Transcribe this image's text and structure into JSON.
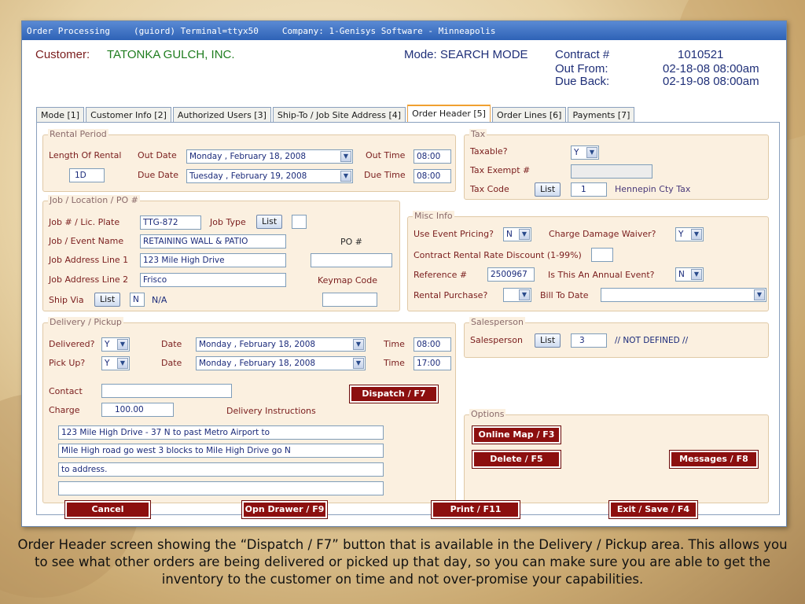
{
  "title_bar": {
    "app": "Order Processing",
    "user": "(guiord) Terminal=ttyx50",
    "company": "Company: 1-Genisys Software - Minneapolis"
  },
  "header": {
    "customer_label": "Customer:",
    "customer_name": "TATONKA GULCH, INC.",
    "mode": "Mode: SEARCH MODE",
    "contract_label": "Contract #",
    "contract_value": "1010521",
    "out_from_label": "Out From:",
    "out_from_value": "02-18-08 08:00am",
    "due_back_label": "Due Back:",
    "due_back_value": "02-19-08 08:00am"
  },
  "tabs": [
    "Mode [1]",
    "Customer Info [2]",
    "Authorized Users [3]",
    "Ship-To / Job Site Address [4]",
    "Order Header [5]",
    "Order Lines [6]",
    "Payments [7]"
  ],
  "rental": {
    "legend": "Rental Period",
    "length_label": "Length Of Rental",
    "length_value": "1D",
    "out_date_label": "Out Date",
    "out_date_value": "Monday   ,  February  18, 2008",
    "due_date_label": "Due Date",
    "due_date_value": "Tuesday  ,  February  19, 2008",
    "out_time_label": "Out Time",
    "out_time_value": "08:00",
    "due_time_label": "Due Time",
    "due_time_value": "08:00"
  },
  "tax": {
    "legend": "Tax",
    "taxable_label": "Taxable?",
    "taxable_value": "Y",
    "exempt_label": "Tax Exempt #",
    "exempt_value": "",
    "code_label": "Tax Code",
    "list_label": "List",
    "code_value": "1",
    "code_desc": "Hennepin Cty Tax"
  },
  "job": {
    "legend": "Job / Location / PO #",
    "plate_label": "Job # / Lic. Plate",
    "plate_value": "TTG-872",
    "type_label": "Job Type",
    "list_label": "List",
    "type_value": "",
    "event_label": "Job / Event Name",
    "event_value": "RETAINING WALL & PATIO",
    "po_label": "PO #",
    "po_value": "",
    "addr1_label": "Job Address Line 1",
    "addr1_value": "123 Mile High Drive",
    "addr2_label": "Job Address Line 2",
    "addr2_value": "Frisco",
    "keymap_label": "Keymap Code",
    "keymap_value": "",
    "shipvia_label": "Ship Via",
    "shipvia_value": "N",
    "shipvia_desc": "N/A"
  },
  "misc": {
    "legend": "Misc Info",
    "event_pricing_label": "Use Event Pricing?",
    "event_pricing_value": "N",
    "damage_label": "Charge Damage Waiver?",
    "damage_value": "Y",
    "discount_label": "Contract Rental Rate Discount (1-99%)",
    "discount_value": "",
    "reference_label": "Reference #",
    "reference_value": "2500967",
    "annual_label": "Is This An Annual Event?",
    "annual_value": "N",
    "purchase_label": "Rental Purchase?",
    "purchase_value": "",
    "billto_label": "Bill To Date",
    "billto_value": ""
  },
  "delivery": {
    "legend": "Delivery / Pickup",
    "delivered_label": "Delivered?",
    "delivered_value": "Y",
    "pickup_label": "Pick Up?",
    "pickup_value": "Y",
    "date_label": "Date",
    "delivered_date": "Monday   ,  February  18, 2008",
    "pickup_date": "Monday   ,  February  18, 2008",
    "time_label": "Time",
    "delivered_time": "08:00",
    "pickup_time": "17:00",
    "contact_label": "Contact",
    "contact_value": "",
    "charge_label": "Charge",
    "charge_value": "100.00",
    "instructions_label": "Delivery Instructions",
    "dispatch_button": "Dispatch / F7",
    "instructions": [
      "123 Mile High Drive - 37 N to past Metro Airport to",
      "Mile High road go west 3 blocks to Mile High Drive go N",
      "to address.",
      ""
    ]
  },
  "salesperson": {
    "legend": "Salesperson",
    "label": "Salesperson",
    "list_label": "List",
    "value": "3",
    "desc": "// NOT DEFINED //"
  },
  "options": {
    "legend": "Options",
    "online_map": "Online Map / F3",
    "delete": "Delete / F5",
    "messages": "Messages / F8"
  },
  "footer": {
    "cancel": "Cancel",
    "drawer": "Opn Drawer / F9",
    "print": "Print / F11",
    "exit": "Exit / Save / F4"
  },
  "caption": "Order Header screen showing the “Dispatch / F7” button that is available in the Delivery / Pickup area. This allows you to see what other orders are being delivered or picked up that day, so you can make sure you are able to get the inventory to the customer on time and not over-promise your capabilities."
}
